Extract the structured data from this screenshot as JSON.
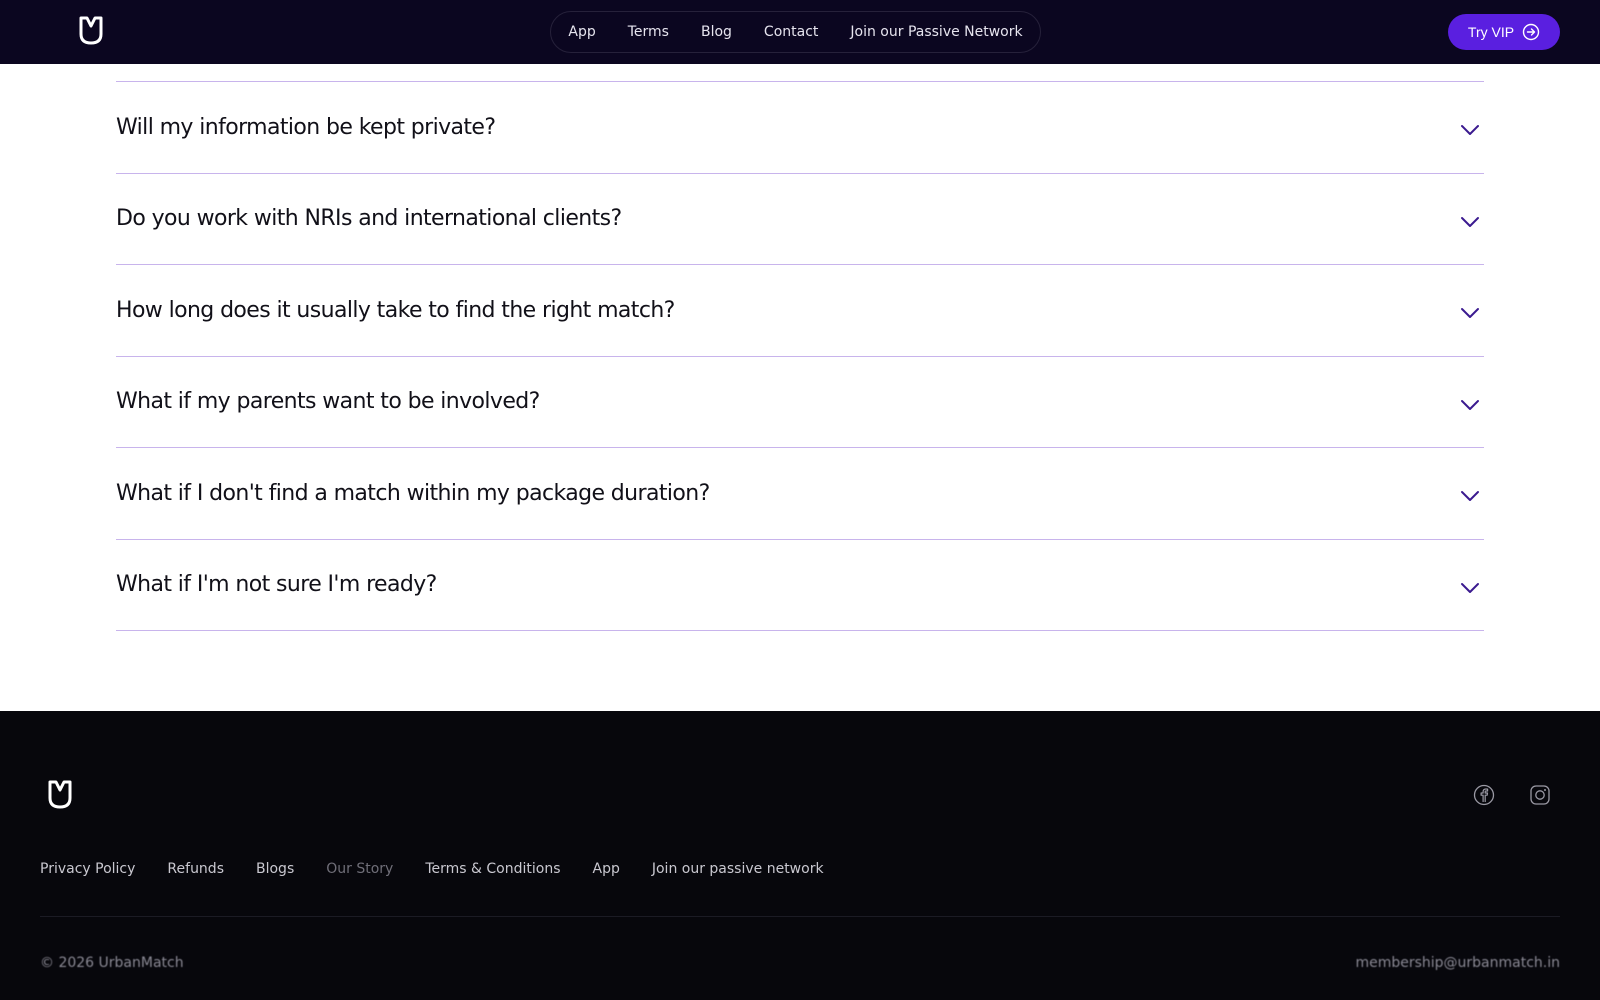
{
  "header": {
    "logo_icon": "urbanmatch-logo-icon",
    "nav": [
      {
        "label": "App"
      },
      {
        "label": "Terms"
      },
      {
        "label": "Blog"
      },
      {
        "label": "Contact"
      },
      {
        "label": "Join our Passive Network"
      }
    ],
    "cta_label": "Try VIP",
    "cta_icon": "arrow-right-circle-icon",
    "cta_color": "#5a1fe0"
  },
  "faq": {
    "items": [
      {
        "question": "Will my information be kept private?"
      },
      {
        "question": "Do you work with NRIs and international clients?"
      },
      {
        "question": "How long does it usually take to find the right match?"
      },
      {
        "question": "What if my parents want to be involved?"
      },
      {
        "question": "What if I don't find a match within my package duration?"
      },
      {
        "question": "What if I'm not sure I'm ready?"
      }
    ],
    "chevron_color": "#3b1a8f",
    "divider_color": "#c8b4ec"
  },
  "footer": {
    "logo_icon": "urbanmatch-logo-icon",
    "social": [
      {
        "icon": "facebook-icon"
      },
      {
        "icon": "instagram-icon"
      }
    ],
    "links": [
      {
        "label": "Privacy Policy"
      },
      {
        "label": "Refunds"
      },
      {
        "label": "Blogs"
      },
      {
        "label": "Our Story"
      },
      {
        "label": "Terms & Conditions"
      },
      {
        "label": "App"
      },
      {
        "label": "Join our passive network"
      }
    ],
    "copyright": "© 2026 UrbanMatch",
    "email": "membership@urbanmatch.in"
  }
}
